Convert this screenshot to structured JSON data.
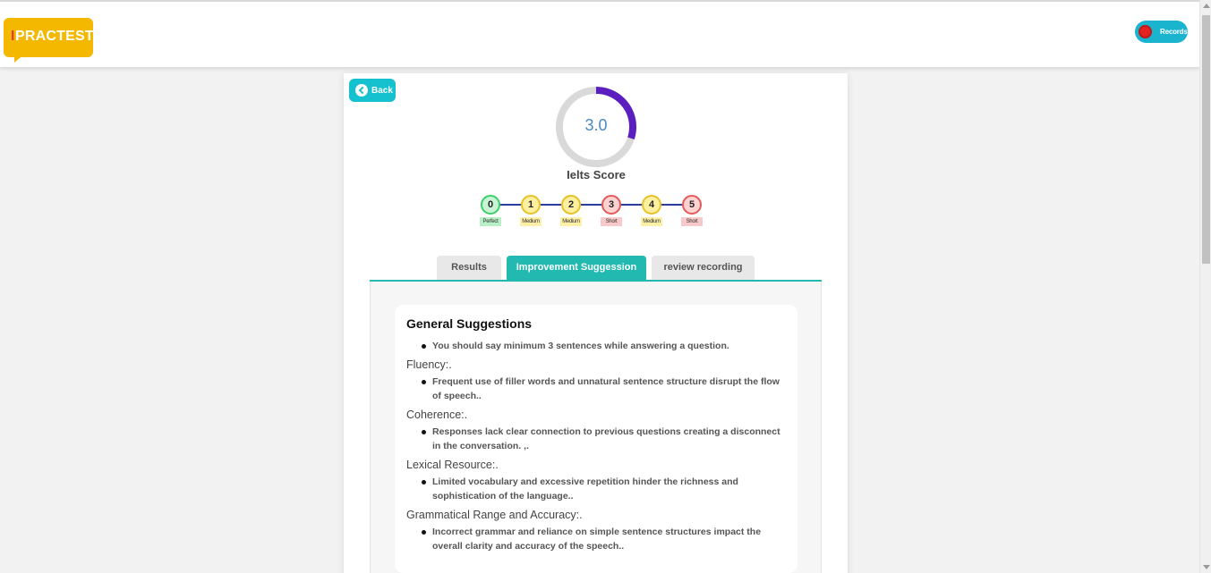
{
  "header": {
    "logo": {
      "accent": "I",
      "text": "PRACTEST"
    },
    "records_label": "Records"
  },
  "back_label": "Back",
  "score": {
    "value": "3.0",
    "fraction": 0.3,
    "label": "Ielts Score"
  },
  "steps": [
    {
      "num": "0",
      "tag": "Perfect",
      "status": "green"
    },
    {
      "num": "1",
      "tag": "Medium",
      "status": "yellow"
    },
    {
      "num": "2",
      "tag": "Medium",
      "status": "yellow"
    },
    {
      "num": "3",
      "tag": "Short",
      "status": "red"
    },
    {
      "num": "4",
      "tag": "Medium",
      "status": "yellow"
    },
    {
      "num": "5",
      "tag": "Short",
      "status": "red"
    }
  ],
  "tabs": [
    {
      "label": "Results",
      "active": false
    },
    {
      "label": "Improvement Suggession",
      "active": true
    },
    {
      "label": "review recording",
      "active": false
    }
  ],
  "suggestions": {
    "title": "General Suggestions",
    "general": [
      "You should say minimum 3 sentences while answering a question."
    ],
    "sections": [
      {
        "heading": "Fluency:.",
        "items": [
          "Frequent use of filler words and unnatural sentence structure disrupt the flow of speech.."
        ]
      },
      {
        "heading": "Coherence:.",
        "items": [
          "Responses lack clear connection to previous questions creating a disconnect in the conversation. ,."
        ]
      },
      {
        "heading": "Lexical Resource:.",
        "items": [
          "Limited vocabulary and excessive repetition hinder the richness and sophistication of the language.."
        ]
      },
      {
        "heading": "Grammatical Range and Accuracy:.",
        "items": [
          "Incorrect grammar and reliance on simple sentence structures impact the overall clarity and accuracy of the speech.."
        ]
      }
    ]
  },
  "colors": {
    "accent_teal": "#21b9b0",
    "back_button": "#16c1cf",
    "gauge_track": "#d9d9d9",
    "gauge_fill": "#5b1fbf",
    "green": {
      "fill": "#c9f3d4",
      "border": "#3ccf6a",
      "tag": "#b9efc6"
    },
    "yellow": {
      "fill": "#fff0a0",
      "border": "#e6c22a",
      "tag": "#fff0a8"
    },
    "red": {
      "fill": "#ffd2d2",
      "border": "#e35a5a",
      "tag": "#f8c9c9"
    }
  }
}
